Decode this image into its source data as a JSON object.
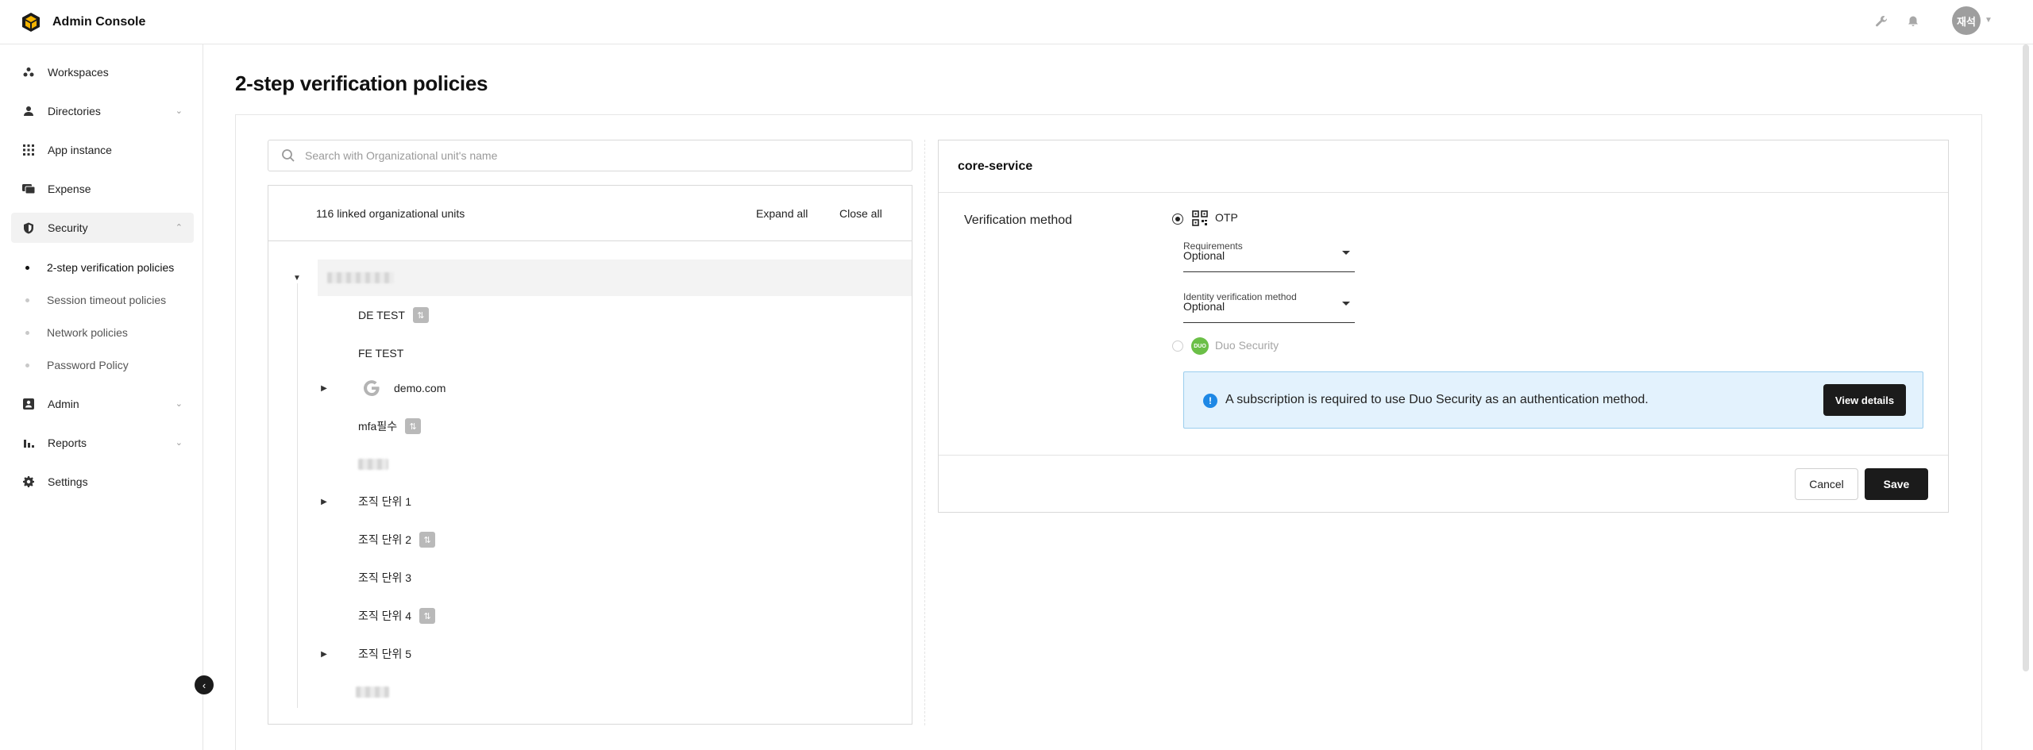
{
  "app": {
    "title": "Admin Console"
  },
  "header": {
    "avatar_text": "재석",
    "icons": [
      "wrench-icon",
      "bell-icon",
      "chevron-down-icon"
    ]
  },
  "sidebar": {
    "items": [
      {
        "label": "Workspaces",
        "icon": "workspaces-icon"
      },
      {
        "label": "Directories",
        "icon": "person-icon"
      },
      {
        "label": "App instance",
        "icon": "grid-icon"
      },
      {
        "label": "Expense",
        "icon": "card-icon"
      },
      {
        "label": "Security",
        "icon": "shield-icon"
      },
      {
        "label": "Admin",
        "icon": "id-badge-icon"
      },
      {
        "label": "Reports",
        "icon": "bar-chart-icon"
      },
      {
        "label": "Settings",
        "icon": "gear-icon"
      }
    ],
    "security_sub": [
      {
        "label": "2-step verification policies"
      },
      {
        "label": "Session timeout policies"
      },
      {
        "label": "Network policies"
      },
      {
        "label": "Password Policy"
      }
    ]
  },
  "page": {
    "title": "2-step verification policies"
  },
  "tree": {
    "search_placeholder": "Search with Organizational unit's name",
    "count_label": "116 linked organizational units",
    "expand_all": "Expand all",
    "close_all": "Close all",
    "nodes": [
      {
        "label": "DE TEST"
      },
      {
        "label": "FE TEST"
      },
      {
        "label": "demo.com"
      },
      {
        "label": "mfa필수"
      },
      {
        "label": "조직 단위 1"
      },
      {
        "label": "조직 단위 2"
      },
      {
        "label": "조직 단위 3"
      },
      {
        "label": "조직 단위 4"
      },
      {
        "label": "조직 단위 5"
      }
    ]
  },
  "policy": {
    "name": "core-service",
    "method_label": "Verification method",
    "otp_label": "OTP",
    "requirements_label": "Requirements",
    "requirements_value": "Optional",
    "identity_label": "Identity verification method",
    "identity_value": "Optional",
    "duo_label": "Duo Security",
    "duo_icon_text": "DUO",
    "notice_text": "A subscription is required to use Duo Security as an authentication method.",
    "view_details": "View details",
    "cancel": "Cancel",
    "save": "Save"
  },
  "colors": {
    "accent_dark": "#1b1b1b",
    "notice_bg": "#e3f2fd",
    "notice_icon": "#1e88e5",
    "duo_green": "#6bbf47"
  }
}
